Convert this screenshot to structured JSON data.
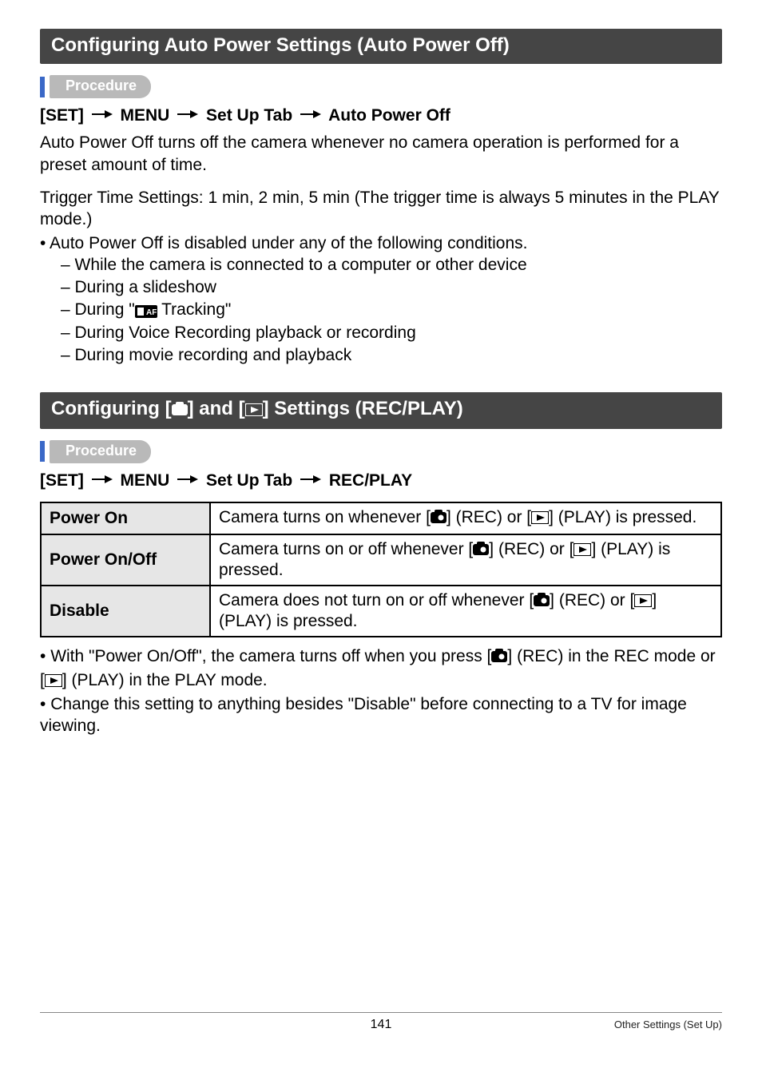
{
  "section1": {
    "title": "Configuring Auto Power Settings (Auto Power Off)",
    "procedure_label": "Procedure",
    "path": [
      "[SET]",
      "MENU",
      "Set Up Tab",
      "Auto Power Off"
    ],
    "para1": "Auto Power Off turns off the camera whenever no camera operation is performed for a preset amount of time.",
    "para2": "Trigger Time Settings: 1 min, 2 min, 5 min (The trigger time is always 5 minutes in the PLAY mode.)",
    "bullet": "Auto Power Off is disabled under any of the following conditions.",
    "subs": {
      "a": "While the camera is connected to a computer or other device",
      "b": "During a slideshow",
      "c_pre": "During \"",
      "c_post": " Tracking\"",
      "d": "During Voice Recording playback or recording",
      "e": "During movie recording and playback"
    }
  },
  "section2": {
    "title_pre": "Configuring [",
    "title_mid": "] and [",
    "title_post": "] Settings (REC/PLAY)",
    "procedure_label": "Procedure",
    "path": [
      "[SET]",
      "MENU",
      "Set Up Tab",
      "REC/PLAY"
    ],
    "table": {
      "r1": {
        "h": "Power On",
        "pre": "Camera turns on whenever [",
        "mid": "] (REC) or [",
        "post": "] (PLAY) is pressed."
      },
      "r2": {
        "h": "Power On/Off",
        "pre": "Camera turns on or off whenever [",
        "mid": "] (REC) or [",
        "post": "] (PLAY) is pressed."
      },
      "r3": {
        "h": "Disable",
        "pre": "Camera does not turn on or off whenever [",
        "mid": "] (REC) or [",
        "post": "] (PLAY) is pressed."
      }
    },
    "notes": {
      "n1_pre": "With \"Power On/Off\", the camera turns off when you press [",
      "n1_mid": "] (REC) in the REC mode or [",
      "n1_post": "] (PLAY) in the PLAY mode.",
      "n2": "Change this setting to anything besides \"Disable\" before connecting to a TV for image viewing."
    }
  },
  "footer": {
    "page": "141",
    "label": "Other Settings (Set Up)"
  }
}
